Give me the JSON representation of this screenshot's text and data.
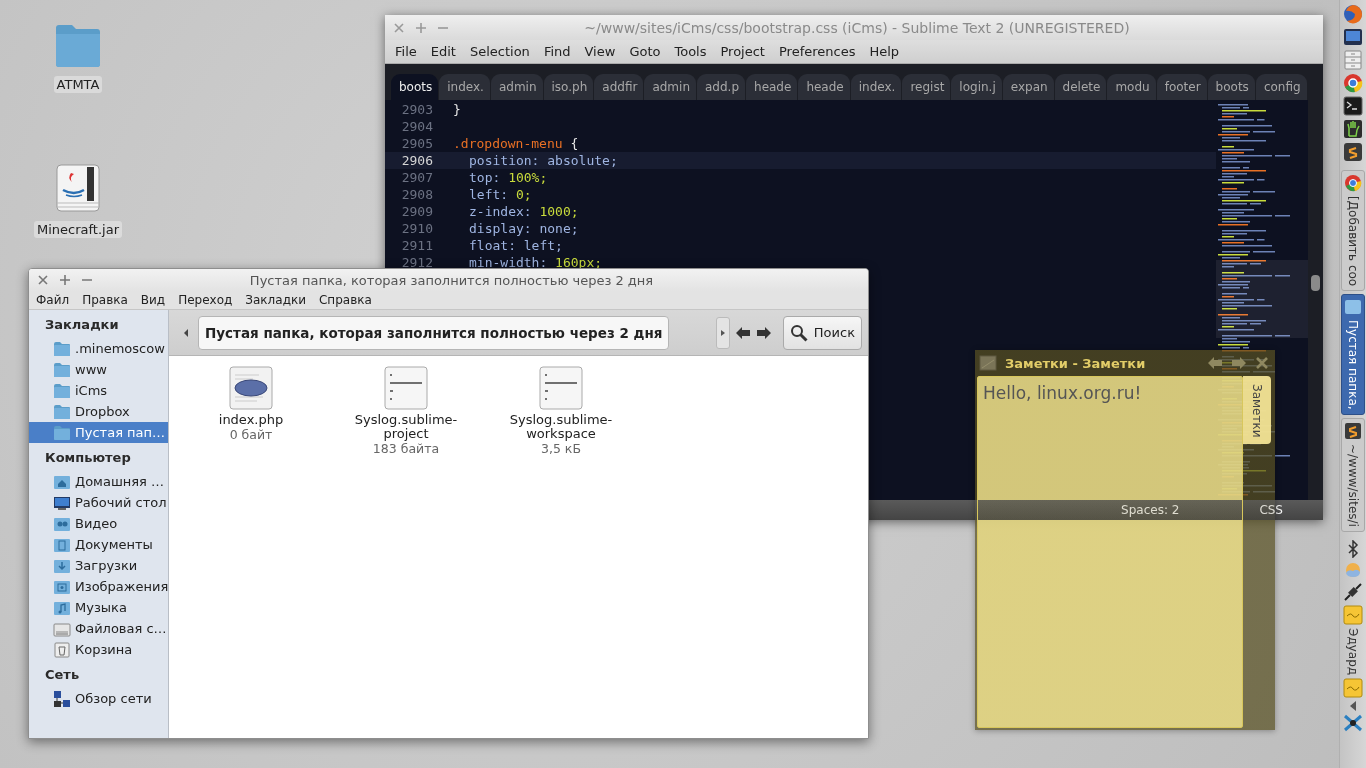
{
  "desktop_icons": [
    {
      "label": "ATMTA",
      "kind": "folder"
    },
    {
      "label": "Minecraft.jar",
      "kind": "jar"
    }
  ],
  "editor": {
    "title": "~/www/sites/iCms/css/bootstrap.css (iCms) - Sublime Text 2 (UNREGISTERED)",
    "menu": [
      "File",
      "Edit",
      "Selection",
      "Find",
      "View",
      "Goto",
      "Tools",
      "Project",
      "Preferences",
      "Help"
    ],
    "tabs": [
      {
        "label": "boots",
        "selected": true
      },
      {
        "label": "index.",
        "selected": false
      },
      {
        "label": "admin",
        "selected": false
      },
      {
        "label": "iso.ph",
        "selected": false
      },
      {
        "label": "addfir",
        "selected": false
      },
      {
        "label": "admin",
        "selected": false
      },
      {
        "label": "add.p",
        "selected": false
      },
      {
        "label": "heade",
        "selected": false
      },
      {
        "label": "heade",
        "selected": false
      },
      {
        "label": "index.",
        "selected": false
      },
      {
        "label": "regist",
        "selected": false
      },
      {
        "label": "login.j",
        "selected": false
      },
      {
        "label": "expan",
        "selected": false
      },
      {
        "label": "delete",
        "selected": false
      },
      {
        "label": "modu",
        "selected": false
      },
      {
        "label": "footer",
        "selected": false
      },
      {
        "label": "boots",
        "selected": false
      },
      {
        "label": "config",
        "selected": false
      }
    ],
    "lines": [
      {
        "number": "2903",
        "current": false,
        "tokens": [
          {
            "text": "}",
            "kind": "punct"
          }
        ]
      },
      {
        "number": "2904",
        "current": false
      },
      {
        "number": "2905",
        "current": false,
        "tokens": [
          {
            "text": ".dropdown-menu",
            "kind": "selector"
          },
          {
            "text": "{",
            "kind": "punct"
          }
        ]
      },
      {
        "number": "2906",
        "current": true,
        "tokens": [
          {
            "text": "position:",
            "kind": "property"
          },
          {
            "text": "absolute;",
            "kind": "keyword"
          }
        ]
      },
      {
        "number": "2907",
        "current": false,
        "tokens": [
          {
            "text": "top:",
            "kind": "property"
          },
          {
            "text": "100%;",
            "kind": "number"
          }
        ]
      },
      {
        "number": "2908",
        "current": false,
        "tokens": [
          {
            "text": "left:",
            "kind": "property"
          },
          {
            "text": "0;",
            "kind": "number"
          }
        ]
      },
      {
        "number": "2909",
        "current": false,
        "tokens": [
          {
            "text": "z-index:",
            "kind": "property"
          },
          {
            "text": "1000;",
            "kind": "number"
          }
        ]
      },
      {
        "number": "2910",
        "current": false,
        "tokens": [
          {
            "text": "display:",
            "kind": "property"
          },
          {
            "text": "none;",
            "kind": "keyword"
          }
        ]
      },
      {
        "number": "2911",
        "current": false,
        "tokens": [
          {
            "text": "float:",
            "kind": "property"
          },
          {
            "text": "left;",
            "kind": "keyword"
          }
        ]
      },
      {
        "number": "2912",
        "current": false,
        "tokens": [
          {
            "text": "min-width:",
            "kind": "property"
          },
          {
            "text": "160px;",
            "kind": "number"
          }
        ]
      }
    ],
    "status": [
      "Spaces: 2",
      "CSS"
    ]
  },
  "file_manager": {
    "title": "Пустая папка, которая заполнится полностью через 2 дня",
    "menu": [
      "Файл",
      "Правка",
      "Вид",
      "Переход",
      "Закладки",
      "Справка"
    ],
    "sidebar": [
      {
        "heading": "Закладки",
        "items": [
          {
            "label": ".minemoscow",
            "kind": "folder",
            "selected": false
          },
          {
            "label": "www",
            "kind": "folder",
            "selected": false
          },
          {
            "label": "iCms",
            "kind": "folder",
            "selected": false
          },
          {
            "label": "Dropbox",
            "kind": "folder",
            "selected": false
          },
          {
            "label": "Пустая пап…",
            "kind": "folder",
            "selected": true
          }
        ]
      },
      {
        "heading": "Компьютер",
        "items": [
          {
            "label": "Домашняя …",
            "kind": "home",
            "selected": false
          },
          {
            "label": "Рабочий стол",
            "kind": "desktop",
            "selected": false
          },
          {
            "label": "Видео",
            "kind": "video",
            "selected": false
          },
          {
            "label": "Документы",
            "kind": "documents",
            "selected": false
          },
          {
            "label": "Загрузки",
            "kind": "downloads",
            "selected": false
          },
          {
            "label": "Изображения",
            "kind": "pictures",
            "selected": false
          },
          {
            "label": "Музыка",
            "kind": "music",
            "selected": false
          },
          {
            "label": "Файловая с…",
            "kind": "drive",
            "selected": false
          },
          {
            "label": "Корзина",
            "kind": "trash",
            "selected": false
          }
        ]
      },
      {
        "heading": "Сеть",
        "items": [
          {
            "label": "Обзор сети",
            "kind": "network",
            "selected": false
          }
        ]
      }
    ],
    "path": "Пустая папка, которая заполнится полностью через 2 дня",
    "search_button": "Поиск",
    "files": [
      {
        "name": "index.php",
        "size": "0 байт",
        "kind": "php"
      },
      {
        "name": "Syslog.sublime-project",
        "size": "183 байта",
        "kind": "text"
      },
      {
        "name": "Syslog.sublime-workspace",
        "size": "3,5 кБ",
        "kind": "text"
      }
    ]
  },
  "notes": {
    "title": "Заметки - Заметки",
    "text": "Hello, linux.org.ru!",
    "tab": "Заметки"
  },
  "dock": {
    "windows": [
      {
        "label": "[Добавить соо",
        "kind": "browser",
        "selected": false
      },
      {
        "label": "Пустая папка,",
        "kind": "folder",
        "selected": true
      },
      {
        "label": "~/www/sites/i",
        "kind": "editor",
        "selected": false
      }
    ],
    "user": "Эдуард"
  }
}
